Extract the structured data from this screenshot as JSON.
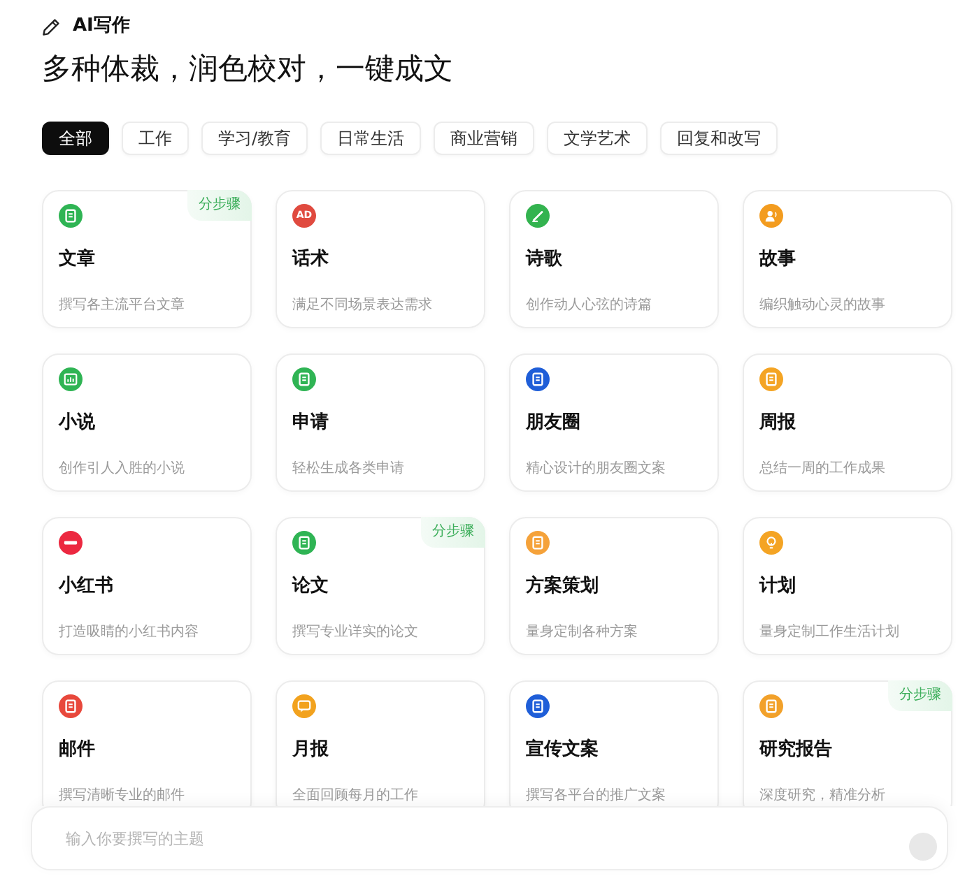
{
  "app": {
    "name": "AI写作"
  },
  "headline": "多种体裁，润色校对，一键成文",
  "tabs": [
    {
      "label": "全部",
      "selected": true
    },
    {
      "label": "工作",
      "selected": false
    },
    {
      "label": "学习/教育",
      "selected": false
    },
    {
      "label": "日常生活",
      "selected": false
    },
    {
      "label": "商业营销",
      "selected": false
    },
    {
      "label": "文学艺术",
      "selected": false
    },
    {
      "label": "回复和改写",
      "selected": false
    }
  ],
  "cards": [
    {
      "title": "文章",
      "description": "撰写各主流平台文章",
      "color": "#2fb454",
      "badge": "分步骤"
    },
    {
      "title": "话术",
      "description": "满足不同场景表达需求",
      "color": "#e04a3f",
      "icon_text": "AD"
    },
    {
      "title": "诗歌",
      "description": "创作动人心弦的诗篇",
      "color": "#33b34f"
    },
    {
      "title": "故事",
      "description": "编织触动心灵的故事",
      "color": "#f39c1f"
    },
    {
      "title": "小说",
      "description": "创作引人入胜的小说",
      "color": "#2fb454"
    },
    {
      "title": "申请",
      "description": "轻松生成各类申请",
      "color": "#2fb454"
    },
    {
      "title": "朋友圈",
      "description": "精心设计的朋友圈文案",
      "color": "#1f5ed8"
    },
    {
      "title": "周报",
      "description": "总结一周的工作成果",
      "color": "#f4a424"
    },
    {
      "title": "小红书",
      "description": "打造吸睛的小红书内容",
      "color": "#ec2840"
    },
    {
      "title": "论文",
      "description": "撰写专业详实的论文",
      "color": "#2fb454",
      "badge": "分步骤"
    },
    {
      "title": "方案策划",
      "description": "量身定制各种方案",
      "color": "#f5a23a"
    },
    {
      "title": "计划",
      "description": "量身定制工作生活计划",
      "color": "#f4a424"
    },
    {
      "title": "邮件",
      "description": "撰写清晰专业的邮件",
      "color": "#e8483c"
    },
    {
      "title": "月报",
      "description": "全面回顾每月的工作",
      "color": "#f2a21e"
    },
    {
      "title": "宣传文案",
      "description": "撰写各平台的推广文案",
      "color": "#1f5ed8"
    },
    {
      "title": "研究报告",
      "description": "深度研究，精准分析",
      "color": "#f2a12a",
      "badge": "分步骤"
    }
  ],
  "prompt": {
    "placeholder": "输入你要撰写的主题"
  }
}
